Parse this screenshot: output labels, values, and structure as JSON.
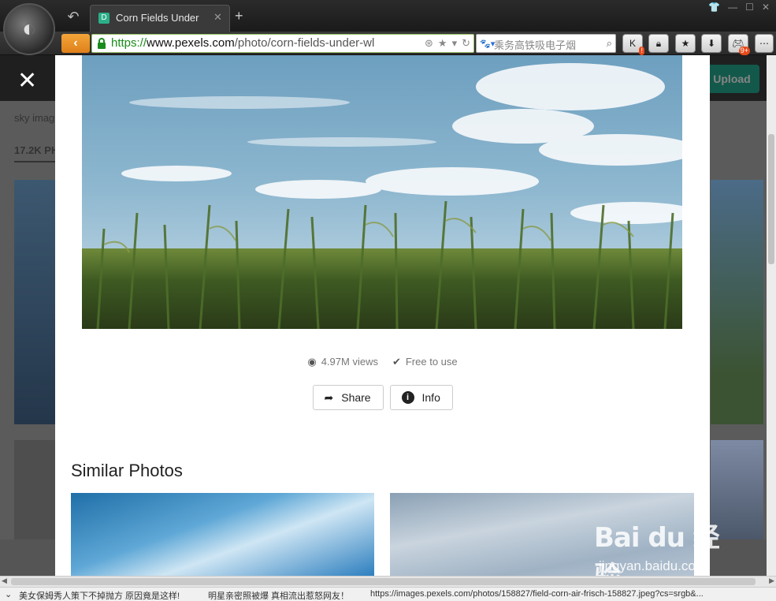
{
  "browser": {
    "tab_title": "Corn Fields Under",
    "tab_favicon": "D",
    "url_secure": "https://",
    "url_host": "www.pexels.com",
    "url_path": "/photo/corn-fields-under-wl",
    "search_text": "乘务高铁吸电子烟",
    "toolbar_badges": {
      "k_badge": "!",
      "game_badge": "9+"
    }
  },
  "background_page": {
    "upload_label": "Upload",
    "search_label": "sky imag",
    "count_label": "17.2K PH"
  },
  "modal": {
    "views": "4.97M views",
    "license": "Free to use",
    "share_label": "Share",
    "info_label": "Info",
    "similar_title": "Similar Photos"
  },
  "status_bar": {
    "item1": "美女保姆秀人策下不掉抛方 原因竟是这样!",
    "item2": "明星亲密照被爆 真相流出惹怒网友！",
    "item3": "https://images.pexels.com/photos/158827/field-corn-air-frisch-158827.jpeg?cs=srgb&..."
  },
  "watermark": {
    "logo": "Bai du 经验",
    "site": "jingyan.baidu.com"
  },
  "colors": {
    "accent_green": "#05a081",
    "nav_orange": "#f3a53a",
    "secure_green": "#1a8c1a"
  }
}
